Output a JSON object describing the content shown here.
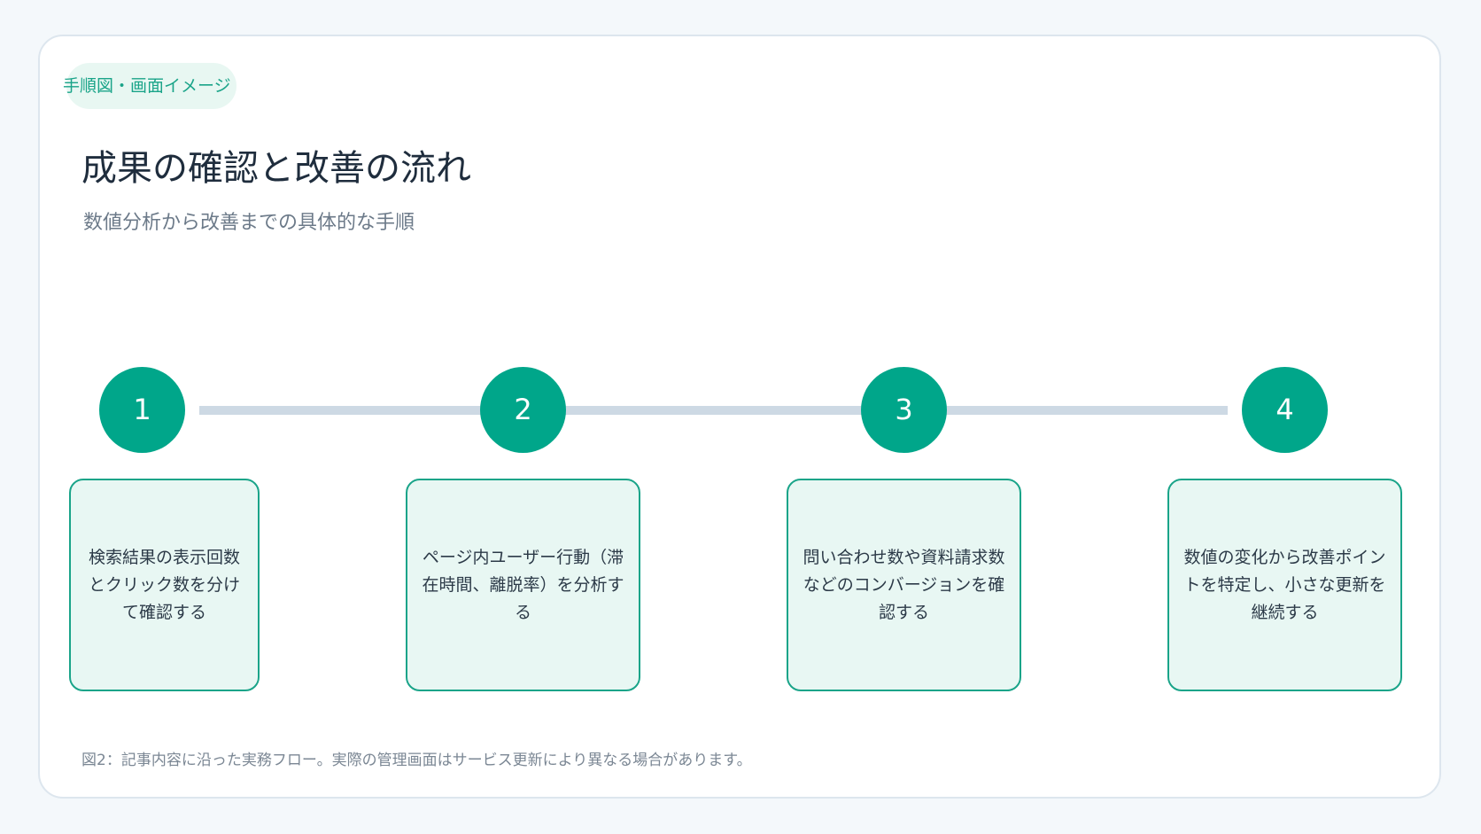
{
  "tag": "手順図・画面イメージ",
  "title": "成果の確認と改善の流れ",
  "subtitle": "数値分析から改善までの具体的な手順",
  "steps": [
    {
      "number": "1",
      "text": "検索結果の表示回数とクリック数を分けて確認する"
    },
    {
      "number": "2",
      "text": "ページ内ユーザー行動（滞在時間、離脱率）を分析する"
    },
    {
      "number": "3",
      "text": "問い合わせ数や資料請求数などのコンバージョンを確認する"
    },
    {
      "number": "4",
      "text": "数値の変化から改善ポイントを特定し、小さな更新を継続する"
    }
  ],
  "caption": "図2：記事内容に沿った実務フロー。実際の管理画面はサービス更新により異なる場合があります。",
  "colors": {
    "accent": "#00a68a",
    "accent_border": "#1aa489",
    "box_fill": "#e8f7f3",
    "connector": "#cdd9e4",
    "background": "#f4f8fb"
  }
}
